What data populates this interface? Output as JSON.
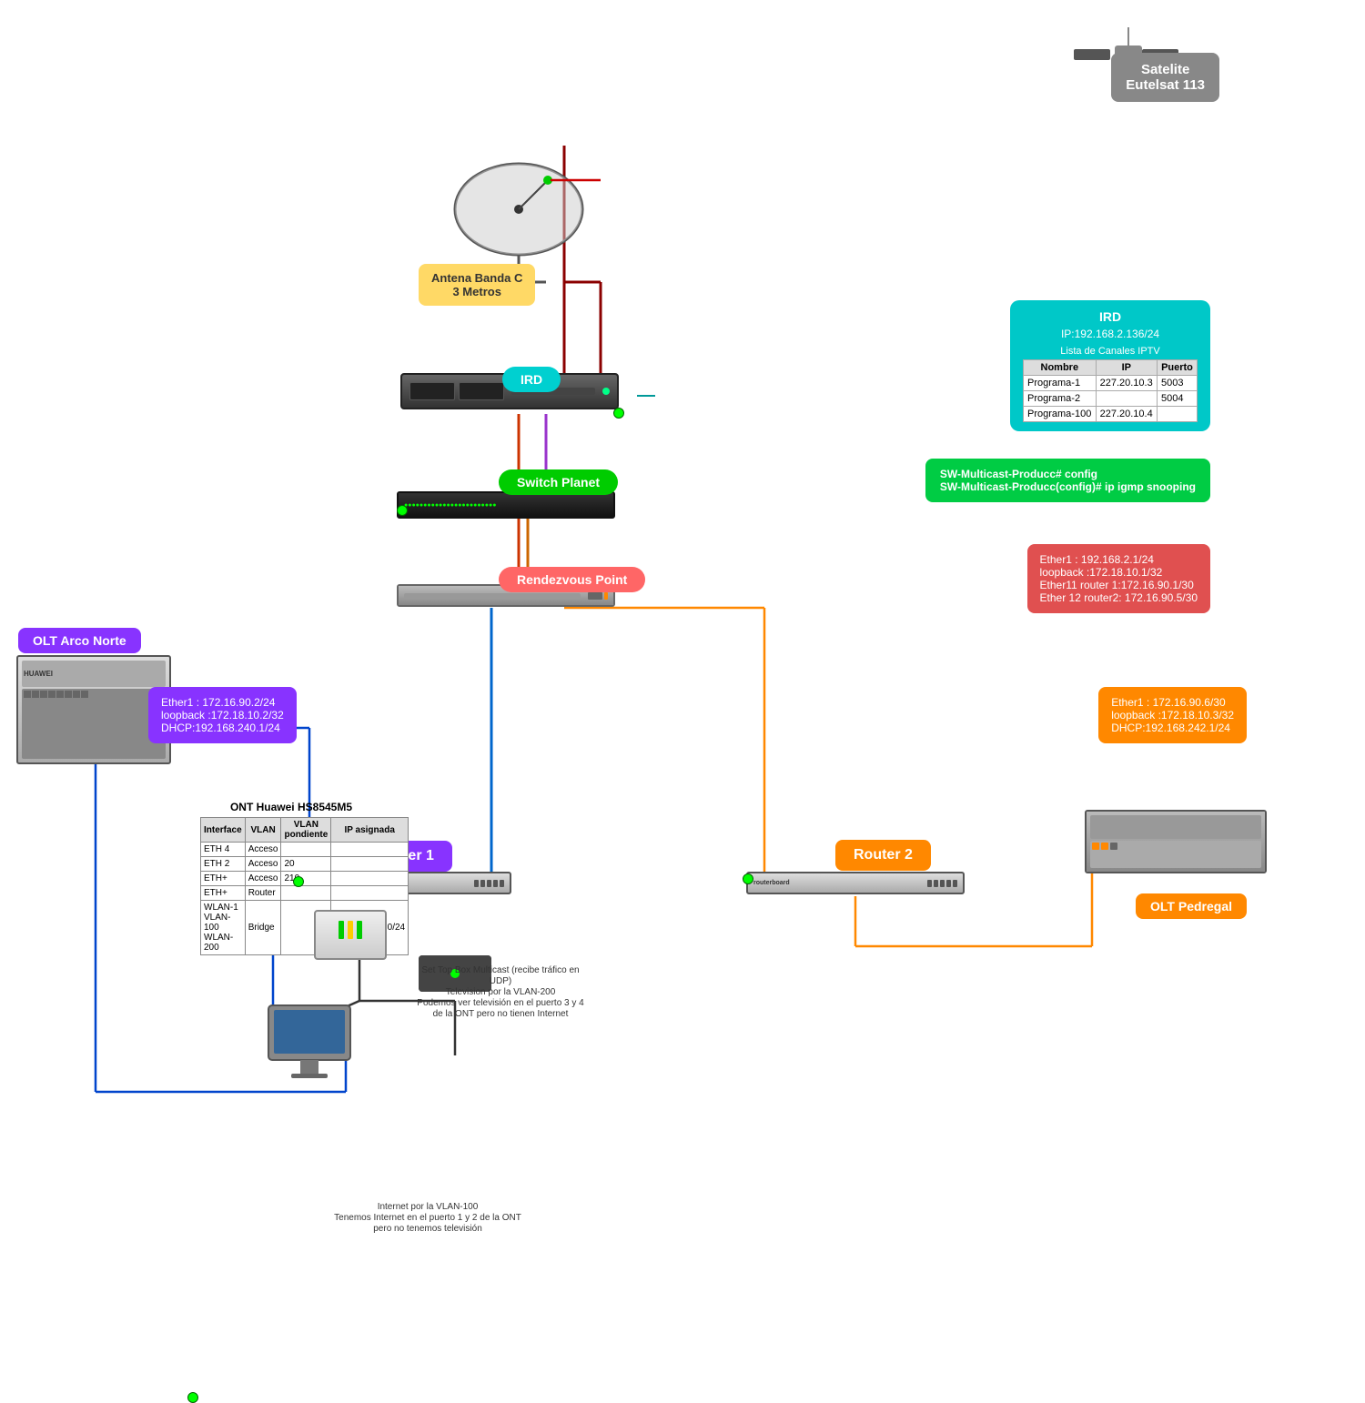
{
  "satellite": {
    "label": "Satelite\nEutelsat 113"
  },
  "antenna": {
    "label": "Antena Banda C\n3 Metros"
  },
  "ird_device": {
    "label": "IRD"
  },
  "ird_info": {
    "title": "IRD",
    "ip": "IP:192.168.2.136/24",
    "table_title": "Lista de Canales IPTV",
    "columns": [
      "Nombre",
      "IP",
      "Puerto"
    ],
    "rows": [
      [
        "Programa-1",
        "227.20.10.3",
        "5003"
      ],
      [
        "Programa-2",
        "",
        "5004"
      ],
      [
        "Programa-100",
        "227.20.10.4",
        ""
      ]
    ]
  },
  "switch": {
    "label": "Switch Planet"
  },
  "config": {
    "line1": "SW-Multicast-Producc# config",
    "line2": "SW-Multicast-Producc(config)# ip igmp snooping"
  },
  "rendezvous": {
    "label": "Rendezvous Point"
  },
  "rp_info": {
    "line1": "Ether1 : 192.168.2.1/24",
    "line2": "loopback :172.18.10.1/32",
    "line3": "Ether11 router 1:172.16.90.1/30",
    "line4": "Ether 12 router2: 172.16.90.5/30"
  },
  "olt_norte": {
    "label": "OLT Arco Norte"
  },
  "router1": {
    "label": "Router  1",
    "info_line1": "Ether1 : 172.16.90.2/24",
    "info_line2": "loopback :172.18.10.2/32",
    "info_line3": "DHCP:192.168.240.1/24"
  },
  "router2": {
    "label": "Router  2",
    "info_line1": "Ether1 : 172.16.90.6/30",
    "info_line2": "loopback :172.18.10.3/32",
    "info_line3": "DHCP:192.168.242.1/24"
  },
  "olt_pedregal": {
    "label": "OLT Pedregal"
  },
  "ont": {
    "title": "ONT Huawei HS8545M5",
    "columns": [
      "Interface",
      "VLAN",
      "VLAN pondiente",
      "IP asignada"
    ],
    "rows": [
      [
        "ETH 4",
        "Acceso",
        "",
        ""
      ],
      [
        "ETH 2",
        "Acceso",
        "20",
        ""
      ],
      [
        "ETH+",
        "Acceso",
        "210",
        ""
      ],
      [
        "ETH+",
        "Router",
        "",
        ""
      ],
      [
        "WLAN-1 VLAN-100 WLAN-200",
        "Bridge",
        "",
        "192.168.100.0/24"
      ]
    ]
  },
  "set_top_box": {
    "text": "Set Top Box Multicast (recibe tráfico en UDP)\nTelevision por la VLAN-200\nPodemos ver televisión en el puerto 3 y 4\nde la ONT pero no tienen Internet"
  },
  "internet_text": {
    "text": "Internet por la VLAN-100\nTenemos Internet en el puerto 1 y 2 de la ONT\npero no tenemos televisión"
  }
}
